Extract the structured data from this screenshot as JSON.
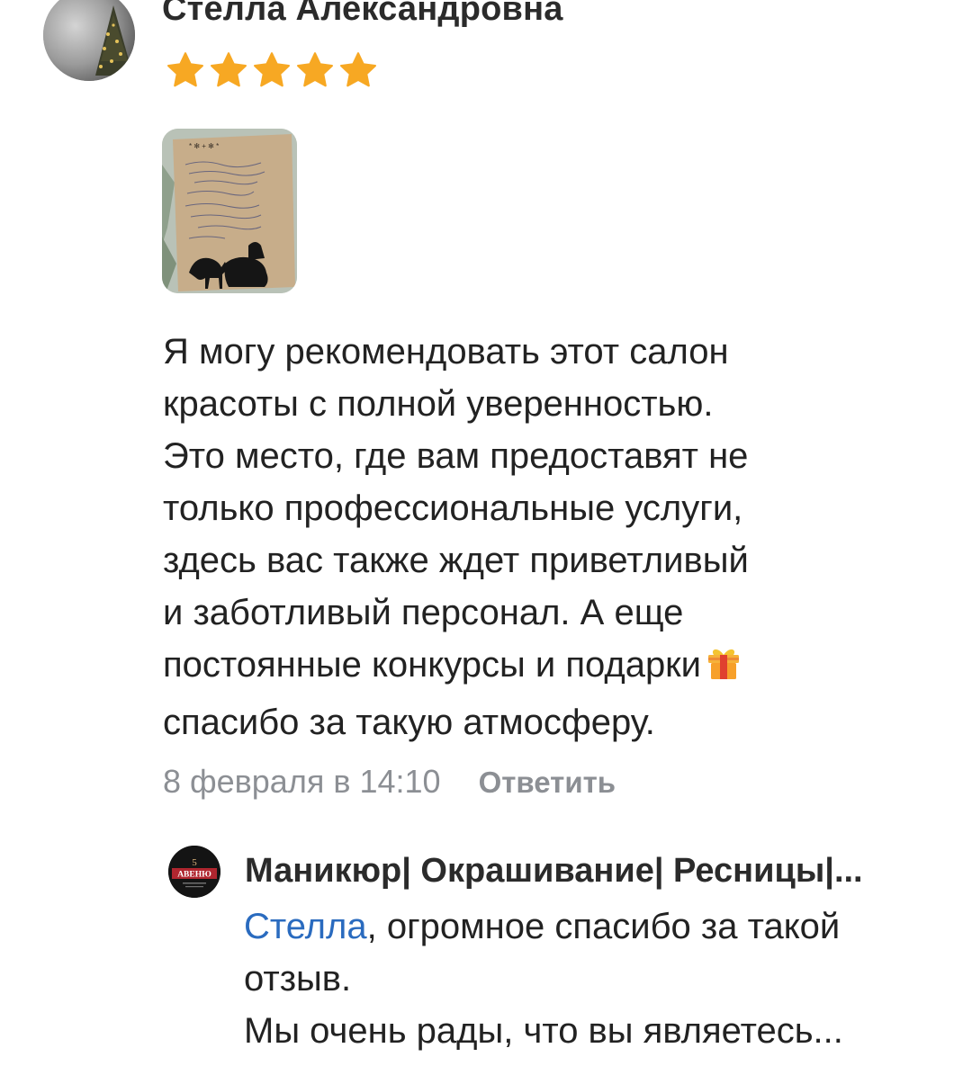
{
  "comment": {
    "author": "Стелла Александровна",
    "rating": 5,
    "rating_max": 5,
    "text_lines": [
      "Я могу рекомендовать этот салон",
      "красоты с полной уверенностью.",
      "Это место, где вам предоставят не",
      "только профессиональные услуги,",
      "здесь вас также ждет приветливый",
      "и заботливый персонал. А еще",
      "постоянные конкурсы и подарки",
      "спасибо за такую атмосферу."
    ],
    "gift_emoji": "gift-icon",
    "date": "8 февраля в 14:10",
    "reply_label": "Ответить"
  },
  "reply": {
    "author": "Маникюр| Окрашивание| Ресницы|...",
    "avatar_lines": [
      "5",
      "АВЕНЮ"
    ],
    "mention": "Стелла",
    "first_line_rest": ", огромное спасибо за такой",
    "text_lines": [
      "отзыв.",
      "Мы очень рады, что вы являетесь..."
    ]
  },
  "colors": {
    "star": "#f7a823",
    "link": "#2a6bbf",
    "meta": "#8c8f94"
  }
}
